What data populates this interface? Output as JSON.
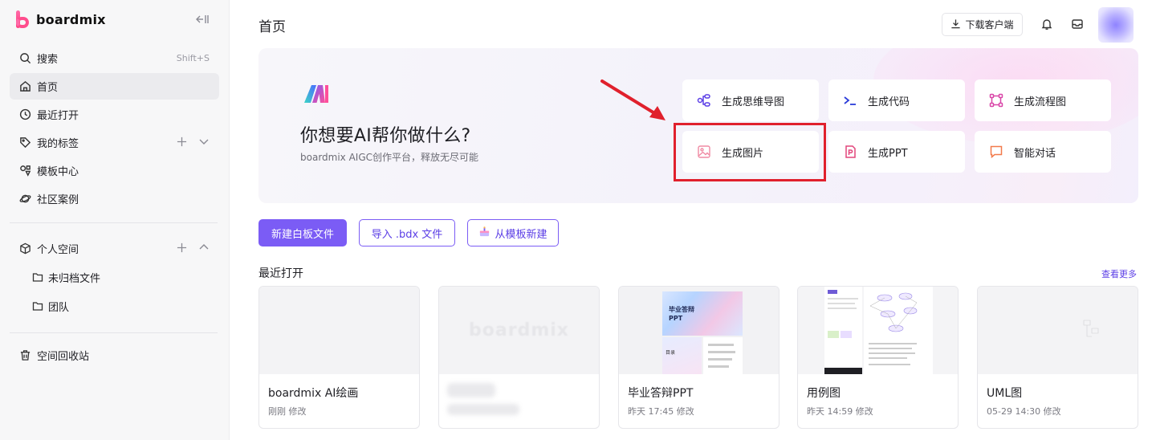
{
  "brand": {
    "name": "boardmix"
  },
  "sidebar": {
    "search": {
      "label": "搜索",
      "shortcut": "Shift+S"
    },
    "items": [
      {
        "label": "首页"
      },
      {
        "label": "最近打开"
      },
      {
        "label": "我的标签"
      },
      {
        "label": "模板中心"
      },
      {
        "label": "社区案例"
      }
    ],
    "personal_space": {
      "label": "个人空间"
    },
    "folders": [
      {
        "label": "未归档文件"
      },
      {
        "label": "团队"
      }
    ],
    "trash": {
      "label": "空间回收站"
    }
  },
  "header": {
    "title": "首页",
    "download_label": "下载客户端"
  },
  "banner": {
    "heading": "你想要AI帮你做什么?",
    "subtitle": "boardmix AIGC创作平台，释放无尽可能",
    "cards": [
      {
        "label": "生成思维导图",
        "icon": "mindmap-icon",
        "color": "#5b3ee6"
      },
      {
        "label": "生成代码",
        "icon": "code-icon",
        "color": "#2b3cd9"
      },
      {
        "label": "生成流程图",
        "icon": "flowchart-icon",
        "color": "#d946a8"
      },
      {
        "label": "生成图片",
        "icon": "image-icon",
        "color": "#f08aa3"
      },
      {
        "label": "生成PPT",
        "icon": "ppt-icon",
        "color": "#e2467c"
      },
      {
        "label": "智能对话",
        "icon": "chat-icon",
        "color": "#f27a4b"
      }
    ]
  },
  "actions": {
    "new_board": "新建白板文件",
    "import_bdx": "导入 .bdx 文件",
    "from_template": "从模板新建"
  },
  "recent": {
    "title": "最近打开",
    "see_more": "查看更多",
    "files": [
      {
        "name": "boardmix AI绘画",
        "meta": "刚刚 修改"
      },
      {
        "name": "",
        "meta": ""
      },
      {
        "name": "毕业答辩PPT",
        "meta": "昨天 17:45 修改"
      },
      {
        "name": "用例图",
        "meta": "昨天 14:59 修改"
      },
      {
        "name": "UML图",
        "meta": "05-29 14:30 修改"
      }
    ],
    "thumb_texts": {
      "watermark": "boardmix",
      "ppt_title": "毕业答辩\nPPT",
      "ppt_toc": "目录"
    }
  },
  "colors": {
    "accent": "#7b5cf5",
    "highlight": "#e0202c"
  }
}
